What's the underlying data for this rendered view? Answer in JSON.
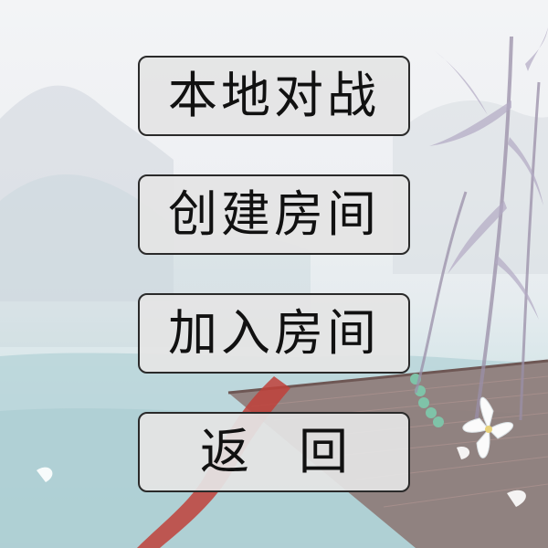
{
  "menu": {
    "local_battle_label": "本地对战",
    "create_room_label": "创建房间",
    "join_room_label": "加入房间",
    "back_label": "返　回"
  },
  "colors": {
    "button_bg": "#e4e4e4",
    "button_border": "#2a2a2a",
    "text": "#111111",
    "water": "#bcd8dc",
    "bridge": "#8a6f6a",
    "ribbon": "#c0392b"
  }
}
